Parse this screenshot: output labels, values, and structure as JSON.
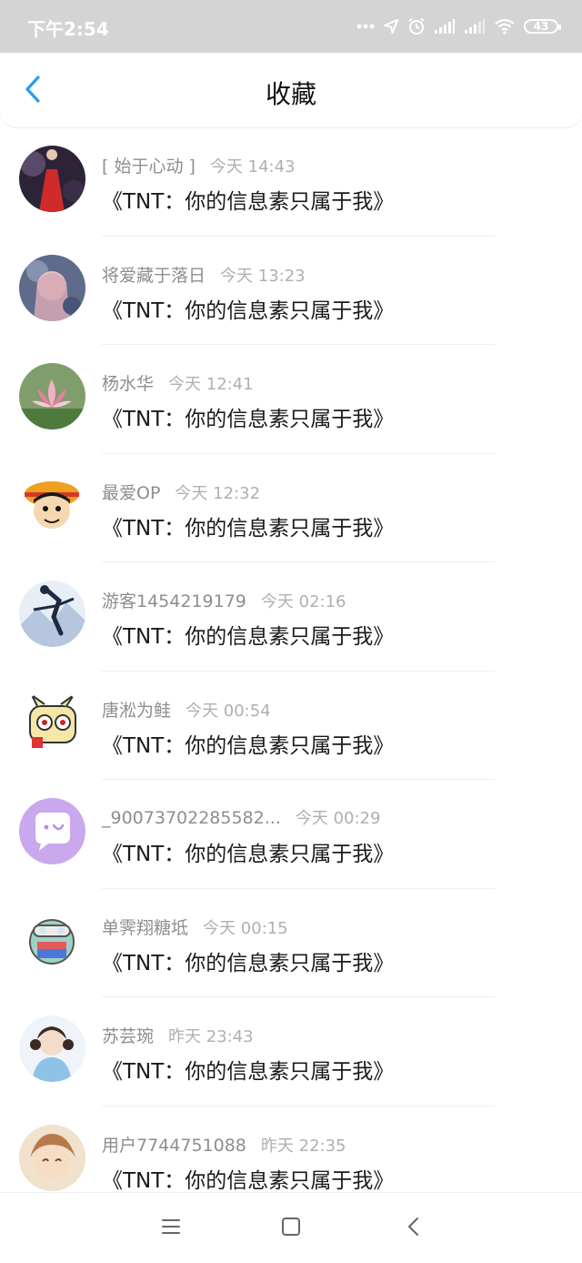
{
  "status": {
    "time": "下午2:54",
    "battery": "43"
  },
  "header": {
    "title": "收藏",
    "back_icon": "chevron-left-icon"
  },
  "items": [
    {
      "name": "[ 始于心动 ]",
      "time": "今天 14:43",
      "message": "《TNT：你的信息素只属于我》"
    },
    {
      "name": "将爱藏于落日",
      "time": "今天 13:23",
      "message": "《TNT：你的信息素只属于我》"
    },
    {
      "name": "杨水华",
      "time": "今天 12:41",
      "message": "《TNT：你的信息素只属于我》"
    },
    {
      "name": "最爱OP",
      "time": "今天 12:32",
      "message": "《TNT：你的信息素只属于我》"
    },
    {
      "name": "游客1454219179",
      "time": "今天 02:16",
      "message": "《TNT：你的信息素只属于我》"
    },
    {
      "name": "唐淞为鲑",
      "time": "今天 00:54",
      "message": "《TNT：你的信息素只属于我》"
    },
    {
      "name": "_90073702285582...",
      "time": "今天 00:29",
      "message": "《TNT：你的信息素只属于我》"
    },
    {
      "name": "单霁翔糖坻",
      "time": "今天 00:15",
      "message": "《TNT：你的信息素只属于我》"
    },
    {
      "name": "苏芸琬",
      "time": "昨天 23:43",
      "message": "《TNT：你的信息素只属于我》"
    },
    {
      "name": "用户7744751088",
      "time": "昨天 22:35",
      "message": "《TNT：你的信息素只属于我》"
    }
  ],
  "nav": {
    "menu_icon": "menu-icon",
    "home_icon": "home-square-icon",
    "back_icon": "back-triangle-icon"
  },
  "colors": {
    "accent": "#2a9bf0",
    "status_bar": "#d4d4d4",
    "meta_text": "#9a9a9a"
  }
}
